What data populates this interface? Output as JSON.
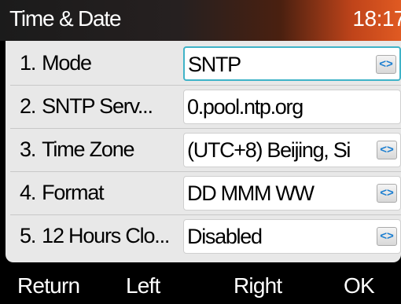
{
  "header": {
    "title": "Time & Date",
    "clock": "18:17"
  },
  "menu": {
    "items": [
      {
        "num": "1.",
        "label": "Mode",
        "value": "SNTP",
        "has_switch": true,
        "selected": true,
        "switch_icon": "left-right-arrows-icon"
      },
      {
        "num": "2.",
        "label": "SNTP Serv...",
        "value": "0.pool.ntp.org",
        "has_switch": false,
        "selected": false
      },
      {
        "num": "3.",
        "label": "Time Zone",
        "value": "(UTC+8) Beijing, Si",
        "has_switch": true,
        "selected": false,
        "switch_icon": "left-right-arrows-icon"
      },
      {
        "num": "4.",
        "label": "Format",
        "value": "DD MMM WW",
        "has_switch": true,
        "selected": false,
        "switch_icon": "left-right-arrows-icon"
      },
      {
        "num": "5.",
        "label": "12 Hours Clo...",
        "value": "Disabled",
        "has_switch": true,
        "selected": false,
        "switch_icon": "left-right-arrows-icon"
      }
    ],
    "switch_glyph": "<>"
  },
  "softkeys": {
    "return": "Return",
    "left": "Left",
    "right": "Right",
    "ok": "OK"
  },
  "colors": {
    "accent_selected_border": "#3fb3c8",
    "switch_arrow": "#1d7fd0",
    "title_gradient_end": "#e05a22",
    "panel_background": "#e8e8e8"
  }
}
